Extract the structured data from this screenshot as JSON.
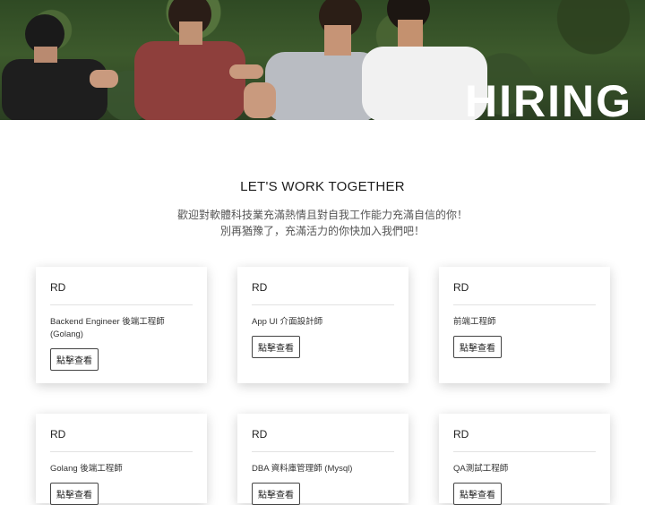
{
  "hero": {
    "heading": "HIRING"
  },
  "intro": {
    "heading": "LET'S WORK TOGETHER",
    "line1": "歡迎對軟體科技業充滿熱情且對自我工作能力充滿自信的你！",
    "line2": "別再猶豫了，充滿活力的你快加入我們吧！"
  },
  "jobs": [
    {
      "dept": "RD",
      "title": "Backend Engineer 後端工程師 (Golang)",
      "button": "點擊查看"
    },
    {
      "dept": "RD",
      "title": "App UI 介面設計師",
      "button": "點擊查看"
    },
    {
      "dept": "RD",
      "title": "前端工程師",
      "button": "點擊查看"
    },
    {
      "dept": "RD",
      "title": "Golang 後端工程師",
      "button": "點擊查看"
    },
    {
      "dept": "RD",
      "title": "DBA 資料庫管理師 (Mysql)",
      "button": "點擊查看"
    },
    {
      "dept": "RD",
      "title": "QA測試工程師",
      "button": "點擊查看"
    }
  ]
}
